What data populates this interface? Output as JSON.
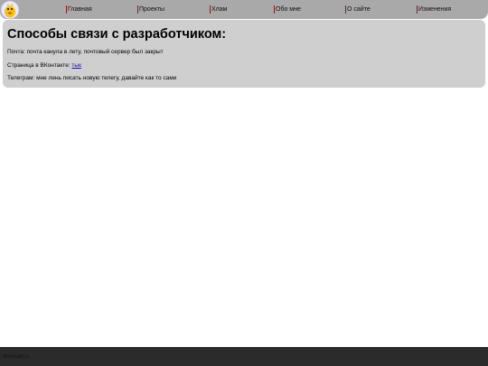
{
  "nav": {
    "items": [
      {
        "label": "Главная"
      },
      {
        "label": "Проекты"
      },
      {
        "label": "Хлам"
      },
      {
        "label": "Обо мне"
      },
      {
        "label": "О сайте"
      },
      {
        "label": "Изменения"
      }
    ],
    "logo_icon": "yellow-mascot-icon"
  },
  "content": {
    "title": "Способы связи с разработчиком:",
    "email_line": "Почта: почта канула в лету, почтовый сервер был закрыт",
    "vk_prefix": "Страница в ВКонтакте: ",
    "vk_link": "тык",
    "telegram_line": "Телеграм: мне лень писать новую телегу, давайте как то сами"
  },
  "footer": {
    "text": "Контакты"
  },
  "colors": {
    "navbar_bg": "#a9a9a9",
    "card_bg": "#cfcfcf",
    "footer_bg": "#2b2b2b",
    "nav_separator": "#8b1a1a",
    "link": "#1a0dab"
  }
}
